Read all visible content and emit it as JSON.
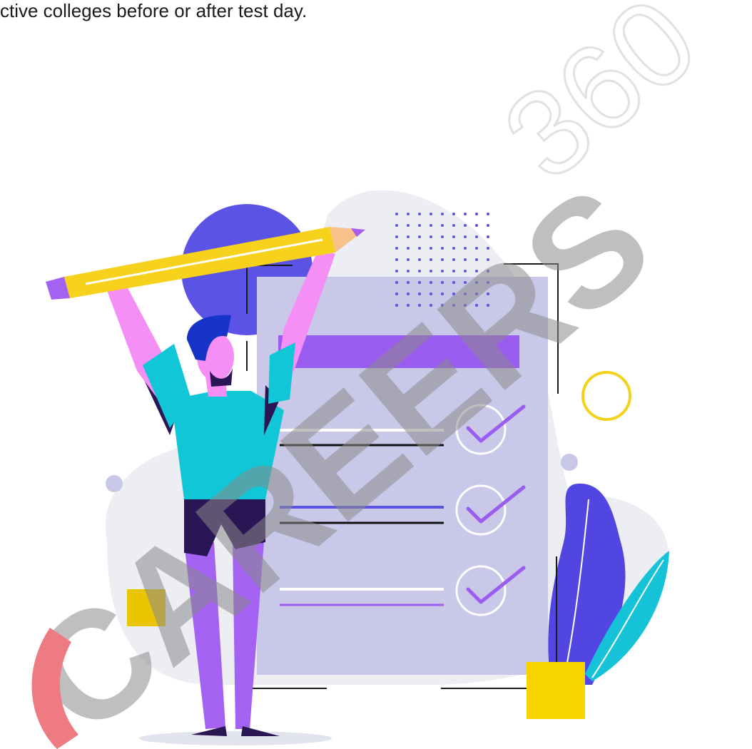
{
  "caption": {
    "text": "ctive colleges before or after test day."
  },
  "watermark": {
    "word": "CAREERS",
    "number": "360"
  },
  "colors": {
    "background": "#ffffff",
    "blob": "#eceef3",
    "purple_circle": "#5b52e6",
    "paper": "#c9c8e8",
    "paper_frame": "#1a1a1a",
    "header_bar": "#9b5cf0",
    "check": "#9b5cf0",
    "pencil_body": "#f7d21c",
    "pencil_tip": "#a65df2",
    "person_shirt": "#11c6d6",
    "person_pants": "#a362f2",
    "person_skin": "#f58ef5",
    "person_hair": "#1734c8",
    "yellow_square": "#f7d400",
    "yellow_ring": "#f2d21a",
    "leaf_blue": "#5146e2",
    "leaf_cyan": "#16c2d8",
    "watermark_red": "#e0101a",
    "watermark_gray": "#8a8a8a"
  }
}
